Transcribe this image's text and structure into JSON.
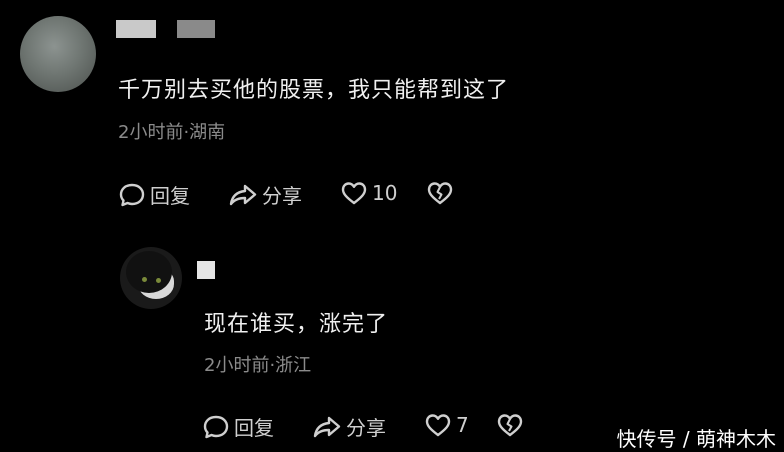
{
  "comments": [
    {
      "text": "千万别去买他的股票，我只能帮到这了",
      "meta": "2小时前·湖南",
      "actions": {
        "reply": "回复",
        "share": "分享",
        "likes": "10"
      }
    },
    {
      "text": "现在谁买，涨完了",
      "meta": "2小时前·浙江",
      "actions": {
        "reply": "回复",
        "share": "分享",
        "likes": "7"
      }
    }
  ],
  "icons": {
    "reply": "speech-bubble-icon",
    "share": "share-arrow-icon",
    "like": "heart-icon",
    "dislike": "broken-heart-icon"
  },
  "watermark": "快传号 / 萌神木木"
}
